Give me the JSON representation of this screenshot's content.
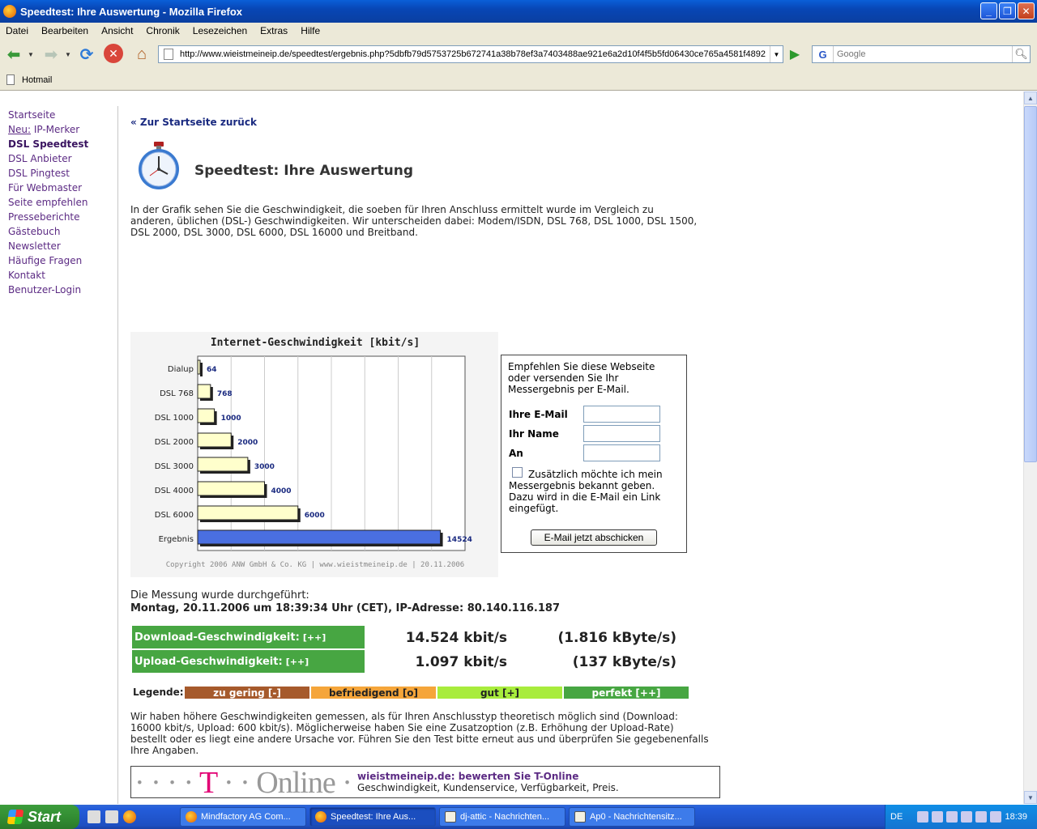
{
  "window": {
    "title": "Speedtest: Ihre Auswertung - Mozilla Firefox"
  },
  "menu": [
    "Datei",
    "Bearbeiten",
    "Ansicht",
    "Chronik",
    "Lesezeichen",
    "Extras",
    "Hilfe"
  ],
  "navbar": {
    "url": "http://www.wieistmeineip.de/speedtest/ergebnis.php?5dbfb79d5753725b672741a38b78ef3a7403488ae921e6a2d10f4f5b5fd06430ce765a4581f4892",
    "search_placeholder": "Google"
  },
  "bookmarks": [
    "Hotmail"
  ],
  "sidebar": {
    "items": [
      {
        "label": "Startseite"
      },
      {
        "prefix": "Neu:",
        "label": " IP-Merker"
      },
      {
        "label": "DSL Speedtest",
        "active": true
      },
      {
        "label": "DSL Anbieter"
      },
      {
        "label": "DSL Pingtest"
      },
      {
        "label": "Für Webmaster"
      },
      {
        "label": "Seite empfehlen"
      },
      {
        "label": "Presseberichte"
      },
      {
        "label": "Gästebuch"
      },
      {
        "label": "Newsletter"
      },
      {
        "label": "Häufige Fragen"
      },
      {
        "label": "Kontakt"
      },
      {
        "label": "Benutzer-Login"
      }
    ]
  },
  "page": {
    "back_link": "« Zur Startseite zurück",
    "title": "Speedtest: Ihre Auswertung",
    "intro": "In der Grafik sehen Sie die Geschwindigkeit, die soeben für Ihren Anschluss ermittelt wurde im Vergleich zu anderen, üblichen (DSL-) Geschwindigkeiten. Wir unterscheiden dabei: Modem/ISDN, DSL 768, DSL 1000, DSL 1500, DSL 2000, DSL 3000, DSL 6000, DSL 16000 und Breitband.",
    "measured_label": "Die Messung wurde durchgeführt:",
    "measured_value": "Montag, 20.11.2006 um 18:39:34 Uhr (CET), IP-Adresse: 80.140.116.187",
    "download": {
      "label": "Download-Geschwindigkeit:",
      "rating": "[++]",
      "kbit": "14.524 kbit/s",
      "kbyte": "(1.816 kByte/s)"
    },
    "upload": {
      "label": "Upload-Geschwindigkeit:",
      "rating": "[++]",
      "kbit": "1.097 kbit/s",
      "kbyte": "(137 kByte/s)"
    },
    "legend_label": "Legende:",
    "legend": [
      {
        "label": "zu gering [-]",
        "color": "#a65a2c",
        "text_color": "#ffffff"
      },
      {
        "label": "befriedigend [o]",
        "color": "#f5a53a",
        "text_color": "#222222"
      },
      {
        "label": "gut [+]",
        "color": "#a8ec3c",
        "text_color": "#222222"
      },
      {
        "label": "perfekt [++]",
        "color": "#47a642",
        "text_color": "#ffffff"
      }
    ],
    "note": "Wir haben höhere Geschwindigkeiten gemessen, als für Ihren Anschlusstyp theoretisch möglich sind (Download: 16000 kbit/s, Upload: 600 kbit/s). Möglicherweise haben Sie eine Zusatzoption (z.B. Erhöhung der Upload-Rate) bestellt oder es liegt eine andere Ursache vor. Führen Sie den Test bitte erneut aus und überprüfen Sie gegebenenfalls Ihre Angaben.",
    "tonline": {
      "logo_t": "T",
      "logo_rest": "Online",
      "heading": "wieistmeineip.de: bewerten Sie T-Online",
      "sub": "Geschwindigkeit, Kundenservice, Verfügbarkeit, Preis."
    }
  },
  "email_form": {
    "intro": "Empfehlen Sie diese Webseite oder versenden Sie Ihr Messergebnis per E-Mail.",
    "email_label": "Ihre E-Mail",
    "name_label": "Ihr Name",
    "to_label": "An",
    "checkbox_text": "Zusätzlich möchte ich mein Messergebnis bekannt geben. Dazu wird in die E-Mail ein Link eingefügt.",
    "submit": "E-Mail jetzt abschicken"
  },
  "chart_data": {
    "type": "bar",
    "title": "Internet-Geschwindigkeit [kbit/s]",
    "categories": [
      "Dialup",
      "DSL 768",
      "DSL 1000",
      "DSL 2000",
      "DSL 3000",
      "DSL 4000",
      "DSL 6000",
      "Ergebnis"
    ],
    "values": [
      64,
      768,
      1000,
      2000,
      3000,
      4000,
      6000,
      14524
    ],
    "xlim": [
      0,
      16000
    ],
    "grid": true,
    "bar_color": "#ffffcc",
    "highlight_color": "#4a6fe0",
    "copyright": "Copyright 2006 ANW GmbH & Co. KG | www.wieistmeineip.de | 20.11.2006"
  },
  "taskbar": {
    "start": "Start",
    "tasks": [
      {
        "label": "Mindfactory AG Com...",
        "icon": "firefox"
      },
      {
        "label": "Speedtest: Ihre Aus...",
        "icon": "firefox",
        "active": true
      },
      {
        "label": "dj-attic - Nachrichten...",
        "icon": "doc"
      },
      {
        "label": "Ap0 - Nachrichtensitz...",
        "icon": "doc"
      }
    ],
    "lang": "DE",
    "time": "18:39"
  }
}
